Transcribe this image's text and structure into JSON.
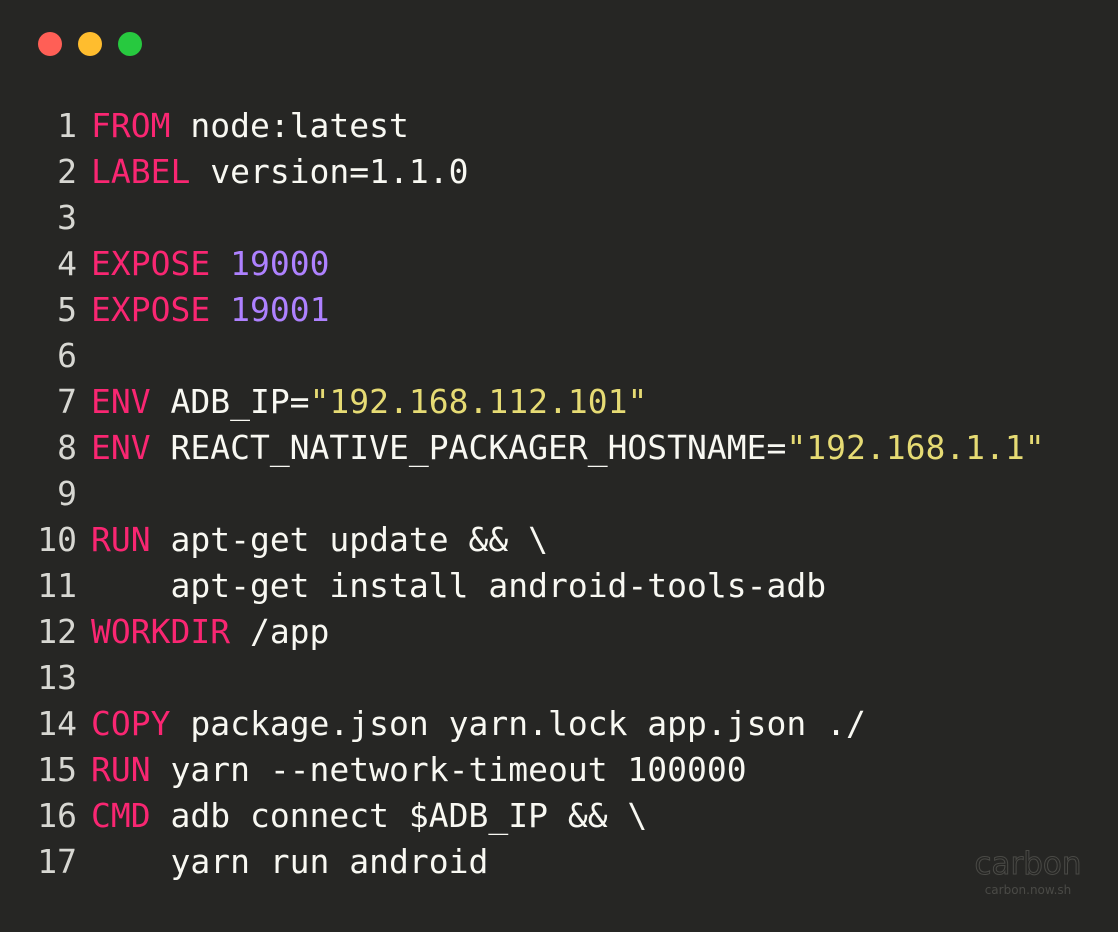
{
  "window": {
    "controls": [
      {
        "name": "close",
        "color": "#ff5f56"
      },
      {
        "name": "minimize",
        "color": "#ffbd2e"
      },
      {
        "name": "maximize",
        "color": "#27c93f"
      }
    ]
  },
  "colors": {
    "background": "#262624",
    "keyword": "#f92672",
    "number": "#ae81ff",
    "string": "#e6db74",
    "text": "#f8f8f2",
    "line_number": "#d7d7d2"
  },
  "code": {
    "lines": [
      {
        "n": "1",
        "tokens": [
          {
            "t": "kw",
            "v": "FROM"
          },
          {
            "t": "txt",
            "v": " node:latest"
          }
        ]
      },
      {
        "n": "2",
        "tokens": [
          {
            "t": "kw",
            "v": "LABEL"
          },
          {
            "t": "txt",
            "v": " version=1.1.0"
          }
        ]
      },
      {
        "n": "3",
        "tokens": []
      },
      {
        "n": "4",
        "tokens": [
          {
            "t": "kw",
            "v": "EXPOSE"
          },
          {
            "t": "txt",
            "v": " "
          },
          {
            "t": "num",
            "v": "19000"
          }
        ]
      },
      {
        "n": "5",
        "tokens": [
          {
            "t": "kw",
            "v": "EXPOSE"
          },
          {
            "t": "txt",
            "v": " "
          },
          {
            "t": "num",
            "v": "19001"
          }
        ]
      },
      {
        "n": "6",
        "tokens": []
      },
      {
        "n": "7",
        "tokens": [
          {
            "t": "kw",
            "v": "ENV"
          },
          {
            "t": "txt",
            "v": " ADB_IP="
          },
          {
            "t": "str",
            "v": "\"192.168.112.101\""
          }
        ]
      },
      {
        "n": "8",
        "tokens": [
          {
            "t": "kw",
            "v": "ENV"
          },
          {
            "t": "txt",
            "v": " REACT_NATIVE_PACKAGER_HOSTNAME="
          },
          {
            "t": "str",
            "v": "\"192.168.1.1\""
          }
        ]
      },
      {
        "n": "9",
        "tokens": []
      },
      {
        "n": "10",
        "tokens": [
          {
            "t": "kw",
            "v": "RUN"
          },
          {
            "t": "txt",
            "v": " apt-get update && \\"
          }
        ]
      },
      {
        "n": "11",
        "tokens": [
          {
            "t": "txt",
            "v": "    apt-get install android-tools-adb"
          }
        ]
      },
      {
        "n": "12",
        "tokens": [
          {
            "t": "kw",
            "v": "WORKDIR"
          },
          {
            "t": "txt",
            "v": " /app"
          }
        ]
      },
      {
        "n": "13",
        "tokens": []
      },
      {
        "n": "14",
        "tokens": [
          {
            "t": "kw",
            "v": "COPY"
          },
          {
            "t": "txt",
            "v": " package.json yarn.lock app.json ./"
          }
        ]
      },
      {
        "n": "15",
        "tokens": [
          {
            "t": "kw",
            "v": "RUN"
          },
          {
            "t": "txt",
            "v": " yarn --network-timeout 100000"
          }
        ]
      },
      {
        "n": "16",
        "tokens": [
          {
            "t": "kw",
            "v": "CMD"
          },
          {
            "t": "txt",
            "v": " adb connect $ADB_IP && \\"
          }
        ]
      },
      {
        "n": "17",
        "tokens": [
          {
            "t": "txt",
            "v": "    yarn run android"
          }
        ]
      }
    ]
  },
  "watermark": {
    "brand": "carbon",
    "url": "carbon.now.sh"
  }
}
